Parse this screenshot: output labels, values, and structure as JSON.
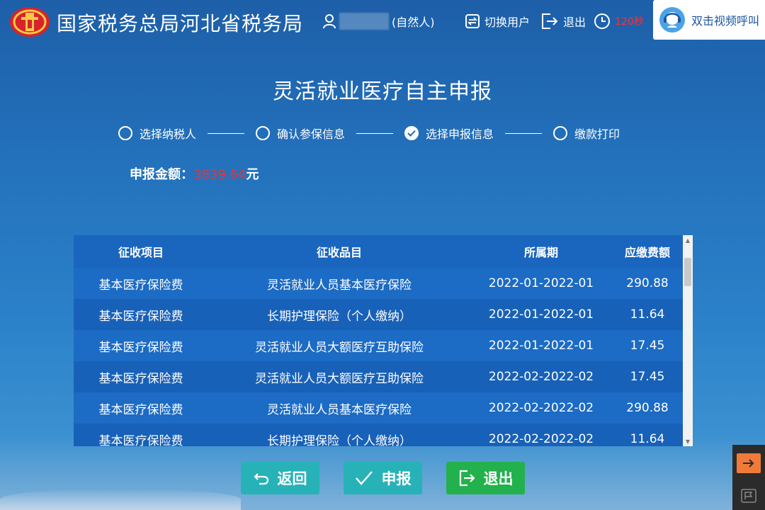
{
  "header": {
    "brand": "国家税务总局河北省税务局",
    "user_suffix": "(自然人)",
    "switch_user": "切换用户",
    "logout": "退出",
    "timer": "120秒",
    "video_call": "双击视频呼叫"
  },
  "title": "灵活就业医疗自主申报",
  "steps": [
    {
      "label": "选择纳税人",
      "done": false
    },
    {
      "label": "确认参保信息",
      "done": false
    },
    {
      "label": "选择申报信息",
      "done": true
    },
    {
      "label": "缴款打印",
      "done": false
    }
  ],
  "amount": {
    "label": "申报金额：",
    "value": "3839.64",
    "unit": "元",
    "value_color": "#ff2a2a"
  },
  "table": {
    "headers": [
      "征收项目",
      "征收品目",
      "所属期",
      "应缴费额"
    ],
    "rows": [
      [
        "基本医疗保险费",
        "灵活就业人员基本医疗保险",
        "2022-01-2022-01",
        "290.88"
      ],
      [
        "基本医疗保险费",
        "长期护理保险（个人缴纳）",
        "2022-01-2022-01",
        "11.64"
      ],
      [
        "基本医疗保险费",
        "灵活就业人员大额医疗互助保险",
        "2022-01-2022-01",
        "17.45"
      ],
      [
        "基本医疗保险费",
        "灵活就业人员大额医疗互助保险",
        "2022-02-2022-02",
        "17.45"
      ],
      [
        "基本医疗保险费",
        "灵活就业人员基本医疗保险",
        "2022-02-2022-02",
        "290.88"
      ],
      [
        "基本医疗保险费",
        "长期护理保险（个人缴纳）",
        "2022-02-2022-02",
        "11.64"
      ]
    ]
  },
  "buttons": {
    "back": "返回",
    "submit": "申报",
    "exit": "退出"
  },
  "colors": {
    "teal_button": "#27b2b8",
    "green_button": "#22b14c",
    "timer_red": "#ff3030"
  }
}
